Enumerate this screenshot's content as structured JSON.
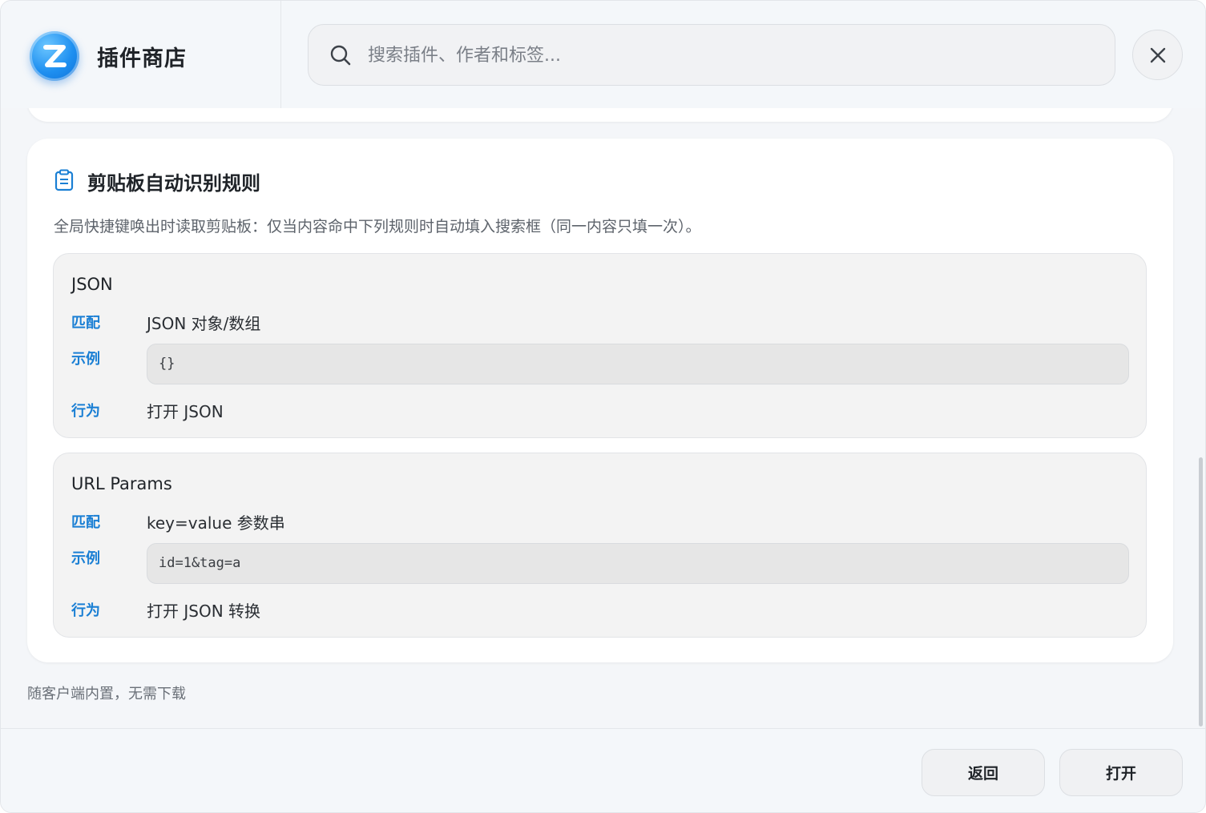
{
  "header": {
    "title": "插件商店",
    "search_placeholder": "搜索插件、作者和标签...",
    "logo_icon": "z-logo-icon",
    "search_icon": "search-icon",
    "close_icon": "close-icon"
  },
  "rules": {
    "title": "剪贴板自动识别规则",
    "description": "全局快捷键唤出时读取剪贴板：仅当内容命中下列规则时自动填入搜索框（同一内容只填一次）。",
    "items": [
      {
        "name": "JSON",
        "match_label": "匹配",
        "match_value": "JSON 对象/数组",
        "example_label": "示例",
        "example_value": "{}",
        "action_label": "行为",
        "action_value": "打开 JSON"
      },
      {
        "name": "URL Params",
        "match_label": "匹配",
        "match_value": "key=value 参数串",
        "example_label": "示例",
        "example_value": "id=1&tag=a",
        "action_label": "行为",
        "action_value": "打开 JSON 转换"
      }
    ]
  },
  "footnote": "随客户端内置，无需下载",
  "footer": {
    "back_label": "返回",
    "open_label": "打开"
  },
  "colors": {
    "accent": "#1a7fd4",
    "logo": "#1e8ff0"
  }
}
